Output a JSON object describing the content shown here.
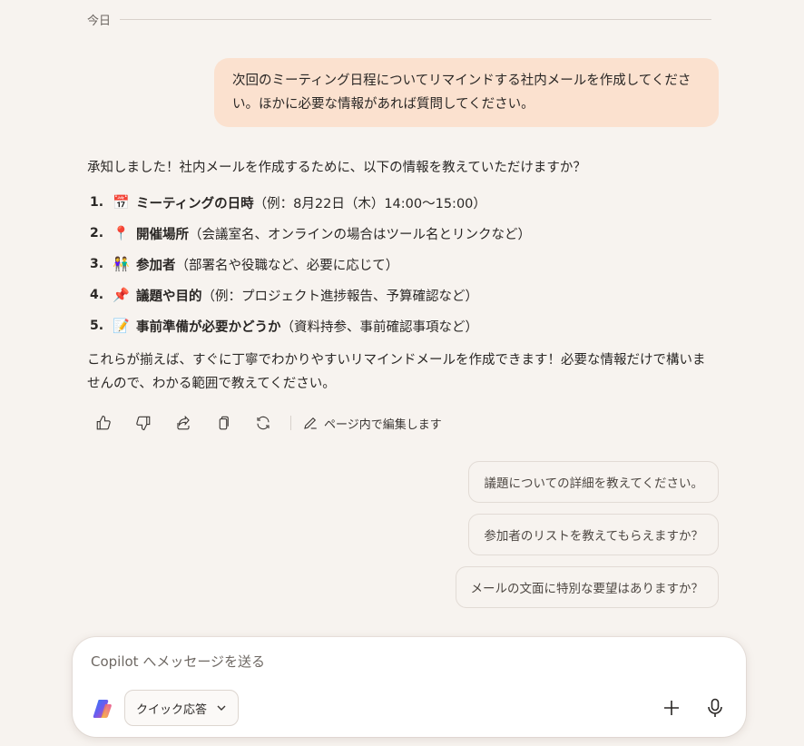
{
  "date_divider": "今日",
  "user_message": "次回のミーティング日程についてリマインドする社内メールを作成してください。ほかに必要な情報があれば質問してください。",
  "response": {
    "intro": "承知しました！社内メールを作成するために、以下の情報を教えていただけますか？",
    "items": [
      {
        "num": "1.",
        "emoji": "📅",
        "bold": "ミーティングの日時",
        "detail": "（例：8月22日（木）14:00〜15:00）"
      },
      {
        "num": "2.",
        "emoji": "📍",
        "bold": "開催場所",
        "detail": "（会議室名、オンラインの場合はツール名とリンクなど）"
      },
      {
        "num": "3.",
        "emoji": "👫",
        "bold": "参加者",
        "detail": "（部署名や役職など、必要に応じて）"
      },
      {
        "num": "4.",
        "emoji": "📌",
        "bold": "議題や目的",
        "detail": "（例：プロジェクト進捗報告、予算確認など）"
      },
      {
        "num": "5.",
        "emoji": "📝",
        "bold": "事前準備が必要かどうか",
        "detail": "（資料持参、事前確認事項など）"
      }
    ],
    "outro": "これらが揃えば、すぐに丁寧でわかりやすいリマインドメールを作成できます！必要な情報だけで構いませんので、わかる範囲で教えてください。"
  },
  "actions": {
    "like": "thumbs-up-icon",
    "dislike": "thumbs-down-icon",
    "share": "share-icon",
    "copy": "copy-icon",
    "regenerate": "refresh-icon",
    "edit_label": "ページ内で編集します"
  },
  "suggestions": [
    "議題についての詳細を教えてください。",
    "参加者のリストを教えてもらえますか？",
    "メールの文面に特別な要望はありますか？"
  ],
  "composer": {
    "placeholder": "Copilot へメッセージを送る",
    "mode_label": "クイック応答"
  },
  "colors": {
    "background": "#f7f3ef",
    "user_bubble": "#fbe1cf",
    "text": "#2a2725"
  }
}
